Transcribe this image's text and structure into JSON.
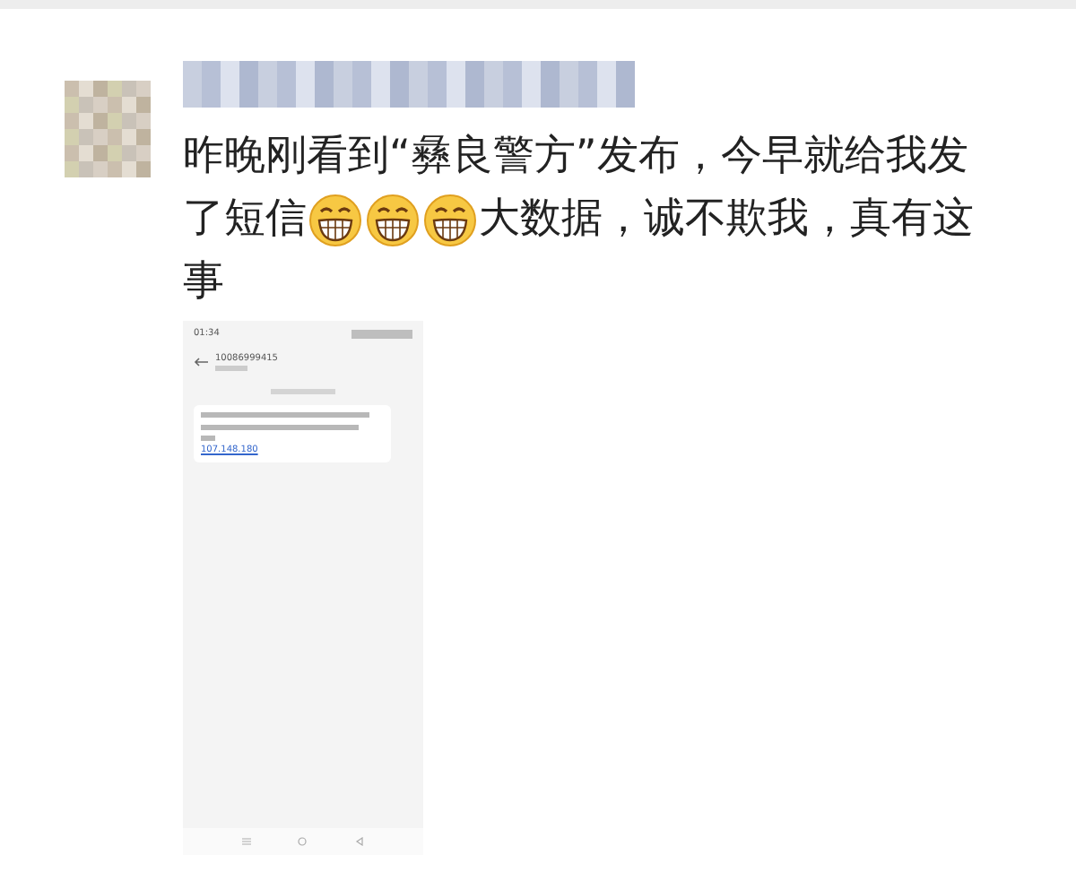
{
  "post": {
    "avatar": {
      "kind": "blurred"
    },
    "author": {
      "kind": "blurred"
    },
    "lines": [
      [
        {
          "kind": "text",
          "text": "昨晚刚看到“彝良警方”发布，今早就给我发"
        }
      ],
      [
        {
          "kind": "text",
          "text": "了短信"
        },
        {
          "kind": "emoji"
        },
        {
          "kind": "emoji"
        },
        {
          "kind": "emoji"
        },
        {
          "kind": "text",
          "text": "大数据，诚不欺我，真有这"
        }
      ],
      [
        {
          "kind": "text",
          "text": "事"
        }
      ]
    ]
  },
  "screenshot": {
    "status_time": "01:34",
    "sender": "10086999415",
    "link": "107.148.180"
  }
}
